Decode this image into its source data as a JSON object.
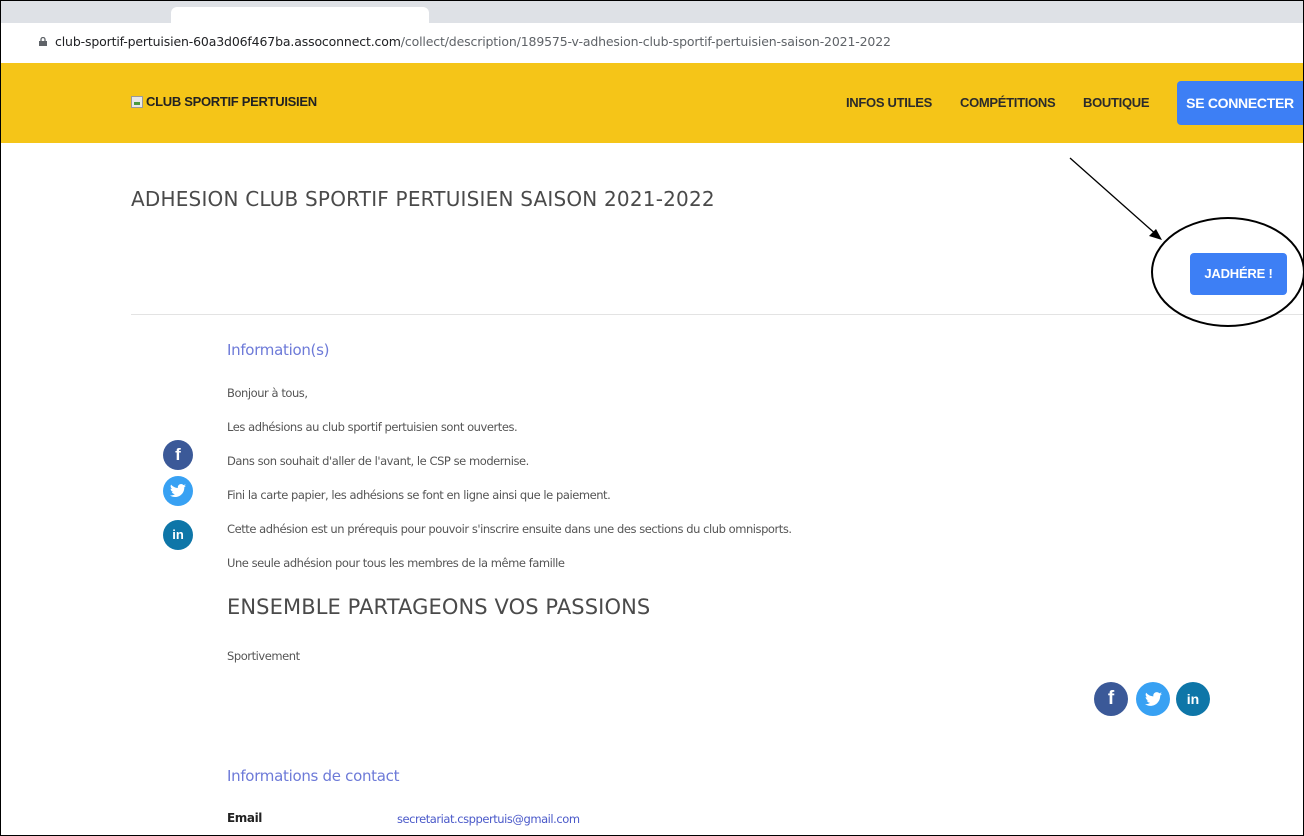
{
  "browser": {
    "url_host": "club-sportif-pertuisien-60a3d06f467ba.assoconnect.com",
    "url_path": "/collect/description/189575-v-adhesion-club-sportif-pertuisien-saison-2021-2022"
  },
  "header": {
    "logo_alt": "CLUB SPORTIF PERTUISIEN",
    "nav": [
      "INFOS UTILES",
      "COMPÉTITIONS",
      "BOUTIQUE"
    ],
    "connect_label": "SE CONNECTER"
  },
  "main": {
    "title": "ADHESION CLUB SPORTIF PERTUISIEN SAISON 2021-2022",
    "adhere_label": "JADHÉRE !",
    "info_heading": "Information(s)",
    "paragraphs": [
      "Bonjour à tous,",
      "Les adhésions au club sportif pertuisien sont ouvertes.",
      "Dans son souhait d'aller de l'avant, le CSP se modernise.",
      "Fini la carte papier, les adhésions se font en ligne ainsi que le paiement.",
      "Cette adhésion est un prérequis pour pouvoir s'inscrire ensuite dans une des sections du club omnisports.",
      "Une seule adhésion pour tous les membres de la même famille"
    ],
    "slogan": "ENSEMBLE PARTAGEONS VOS PASSIONS",
    "signoff": "Sportivement",
    "contact_heading": "Informations de contact",
    "contact": {
      "label": "Email",
      "value": "secretariat.csppertuis@gmail.com"
    }
  },
  "social": {
    "facebook_glyph": "f",
    "twitter_icon": "twitter-bird-icon",
    "linkedin_glyph": "in"
  },
  "colors": {
    "header_bg": "#f5c518",
    "primary_button": "#3d7ff5",
    "link": "#6d7ad8",
    "facebook": "#3b5998",
    "twitter": "#38a1f3",
    "linkedin": "#0e76a8"
  }
}
